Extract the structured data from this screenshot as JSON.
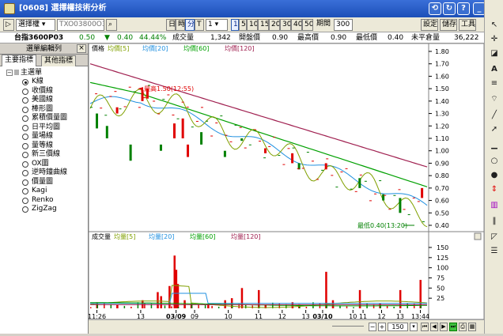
{
  "window": {
    "title": "[0608] 選擇權技術分析"
  },
  "toolbar": {
    "product": "選擇權",
    "code": "TXO03800O3",
    "periods": [
      "日",
      "時",
      "分",
      "T"
    ],
    "period_selected": "分",
    "minute_value": "1",
    "minute_options": [
      "1",
      "5",
      "10",
      "15",
      "20",
      "30",
      "40",
      "50"
    ],
    "cycle_label": "期間",
    "cycle_value": "300",
    "settings_label": "設定",
    "save_label": "儲存",
    "tools_label": "工具"
  },
  "quote": {
    "name": "台指3600P03",
    "price": "0.50",
    "arrow": "▼",
    "change": "0.40",
    "pct": "44.44%",
    "vol_label": "成交量",
    "vol": "1,342",
    "open_label": "開盤價",
    "open": "0.90",
    "high_label": "最高價",
    "high": "0.90",
    "low_label": "最低價",
    "low": "0.40",
    "oi_label": "未平倉量",
    "oi": "36,222"
  },
  "left": {
    "header": "選單編輯列",
    "tabs": [
      "主要指標",
      "其他指標"
    ],
    "root": "主選單",
    "items": [
      "K線",
      "收價線",
      "美國線",
      "棒形圖",
      "累積價量圖",
      "日平均圖",
      "量場線",
      "量等線",
      "新三價線",
      "OX圖",
      "逆時鐘曲線",
      "價量圖",
      "Kagi",
      "Renko",
      "ZigZag"
    ]
  },
  "colors": {
    "up": "#e00000",
    "down": "#008000",
    "ma5": "#80a000",
    "ma20": "#2090e0",
    "ma60": "#00a000",
    "ma120": "#a02050"
  },
  "price_legend": {
    "label": "價格",
    "ma5": "均價[5]",
    "ma20": "均價[20]",
    "ma60": "均價[60]",
    "ma120": "均價[120]"
  },
  "vol_legend": {
    "label": "成交量",
    "ma5": "均量[5]",
    "ma20": "均量[20]",
    "ma60": "均量[60]",
    "ma120": "均量[120]"
  },
  "annotations": {
    "high": "最高1.50(12:55)",
    "low": "最低0.40(13:20)"
  },
  "price_axis": [
    "1.80",
    "1.70",
    "1.60",
    "1.50",
    "1.40",
    "1.30",
    "1.20",
    "1.10",
    "1.00",
    "0.90",
    "0.80",
    "0.70",
    "0.60",
    "0.50",
    "0.40"
  ],
  "vol_axis": [
    "150",
    "125",
    "100",
    "75",
    "50",
    "25"
  ],
  "time_axis": [
    {
      "label": "11:26",
      "pos": 0.02,
      "bold": false
    },
    {
      "label": "13",
      "pos": 0.15,
      "bold": false
    },
    {
      "label": "03/09",
      "pos": 0.255,
      "bold": true
    },
    {
      "label": "09",
      "pos": 0.31,
      "bold": false
    },
    {
      "label": "10",
      "pos": 0.41,
      "bold": false
    },
    {
      "label": "11",
      "pos": 0.5,
      "bold": false
    },
    {
      "label": "12",
      "pos": 0.57,
      "bold": false
    },
    {
      "label": "13",
      "pos": 0.64,
      "bold": false
    },
    {
      "label": "03/10",
      "pos": 0.69,
      "bold": true
    },
    {
      "label": "10",
      "pos": 0.78,
      "bold": false
    },
    {
      "label": "11",
      "pos": 0.81,
      "bold": false
    },
    {
      "label": "12",
      "pos": 0.865,
      "bold": false
    },
    {
      "label": "13",
      "pos": 0.92,
      "bold": false
    },
    {
      "label": "13:44",
      "pos": 0.98,
      "bold": false
    }
  ],
  "zoom_value": "150"
}
